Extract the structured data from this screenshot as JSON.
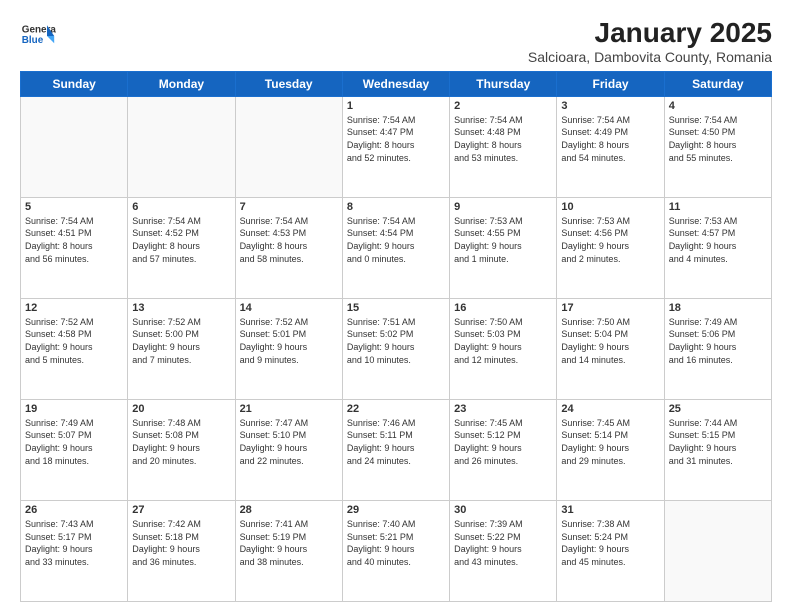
{
  "header": {
    "logo": {
      "general": "General",
      "blue": "Blue"
    },
    "title": "January 2025",
    "subtitle": "Salcioara, Dambovita County, Romania"
  },
  "days_of_week": [
    "Sunday",
    "Monday",
    "Tuesday",
    "Wednesday",
    "Thursday",
    "Friday",
    "Saturday"
  ],
  "weeks": [
    [
      {
        "day": "",
        "info": ""
      },
      {
        "day": "",
        "info": ""
      },
      {
        "day": "",
        "info": ""
      },
      {
        "day": "1",
        "info": "Sunrise: 7:54 AM\nSunset: 4:47 PM\nDaylight: 8 hours\nand 52 minutes."
      },
      {
        "day": "2",
        "info": "Sunrise: 7:54 AM\nSunset: 4:48 PM\nDaylight: 8 hours\nand 53 minutes."
      },
      {
        "day": "3",
        "info": "Sunrise: 7:54 AM\nSunset: 4:49 PM\nDaylight: 8 hours\nand 54 minutes."
      },
      {
        "day": "4",
        "info": "Sunrise: 7:54 AM\nSunset: 4:50 PM\nDaylight: 8 hours\nand 55 minutes."
      }
    ],
    [
      {
        "day": "5",
        "info": "Sunrise: 7:54 AM\nSunset: 4:51 PM\nDaylight: 8 hours\nand 56 minutes."
      },
      {
        "day": "6",
        "info": "Sunrise: 7:54 AM\nSunset: 4:52 PM\nDaylight: 8 hours\nand 57 minutes."
      },
      {
        "day": "7",
        "info": "Sunrise: 7:54 AM\nSunset: 4:53 PM\nDaylight: 8 hours\nand 58 minutes."
      },
      {
        "day": "8",
        "info": "Sunrise: 7:54 AM\nSunset: 4:54 PM\nDaylight: 9 hours\nand 0 minutes."
      },
      {
        "day": "9",
        "info": "Sunrise: 7:53 AM\nSunset: 4:55 PM\nDaylight: 9 hours\nand 1 minute."
      },
      {
        "day": "10",
        "info": "Sunrise: 7:53 AM\nSunset: 4:56 PM\nDaylight: 9 hours\nand 2 minutes."
      },
      {
        "day": "11",
        "info": "Sunrise: 7:53 AM\nSunset: 4:57 PM\nDaylight: 9 hours\nand 4 minutes."
      }
    ],
    [
      {
        "day": "12",
        "info": "Sunrise: 7:52 AM\nSunset: 4:58 PM\nDaylight: 9 hours\nand 5 minutes."
      },
      {
        "day": "13",
        "info": "Sunrise: 7:52 AM\nSunset: 5:00 PM\nDaylight: 9 hours\nand 7 minutes."
      },
      {
        "day": "14",
        "info": "Sunrise: 7:52 AM\nSunset: 5:01 PM\nDaylight: 9 hours\nand 9 minutes."
      },
      {
        "day": "15",
        "info": "Sunrise: 7:51 AM\nSunset: 5:02 PM\nDaylight: 9 hours\nand 10 minutes."
      },
      {
        "day": "16",
        "info": "Sunrise: 7:50 AM\nSunset: 5:03 PM\nDaylight: 9 hours\nand 12 minutes."
      },
      {
        "day": "17",
        "info": "Sunrise: 7:50 AM\nSunset: 5:04 PM\nDaylight: 9 hours\nand 14 minutes."
      },
      {
        "day": "18",
        "info": "Sunrise: 7:49 AM\nSunset: 5:06 PM\nDaylight: 9 hours\nand 16 minutes."
      }
    ],
    [
      {
        "day": "19",
        "info": "Sunrise: 7:49 AM\nSunset: 5:07 PM\nDaylight: 9 hours\nand 18 minutes."
      },
      {
        "day": "20",
        "info": "Sunrise: 7:48 AM\nSunset: 5:08 PM\nDaylight: 9 hours\nand 20 minutes."
      },
      {
        "day": "21",
        "info": "Sunrise: 7:47 AM\nSunset: 5:10 PM\nDaylight: 9 hours\nand 22 minutes."
      },
      {
        "day": "22",
        "info": "Sunrise: 7:46 AM\nSunset: 5:11 PM\nDaylight: 9 hours\nand 24 minutes."
      },
      {
        "day": "23",
        "info": "Sunrise: 7:45 AM\nSunset: 5:12 PM\nDaylight: 9 hours\nand 26 minutes."
      },
      {
        "day": "24",
        "info": "Sunrise: 7:45 AM\nSunset: 5:14 PM\nDaylight: 9 hours\nand 29 minutes."
      },
      {
        "day": "25",
        "info": "Sunrise: 7:44 AM\nSunset: 5:15 PM\nDaylight: 9 hours\nand 31 minutes."
      }
    ],
    [
      {
        "day": "26",
        "info": "Sunrise: 7:43 AM\nSunset: 5:17 PM\nDaylight: 9 hours\nand 33 minutes."
      },
      {
        "day": "27",
        "info": "Sunrise: 7:42 AM\nSunset: 5:18 PM\nDaylight: 9 hours\nand 36 minutes."
      },
      {
        "day": "28",
        "info": "Sunrise: 7:41 AM\nSunset: 5:19 PM\nDaylight: 9 hours\nand 38 minutes."
      },
      {
        "day": "29",
        "info": "Sunrise: 7:40 AM\nSunset: 5:21 PM\nDaylight: 9 hours\nand 40 minutes."
      },
      {
        "day": "30",
        "info": "Sunrise: 7:39 AM\nSunset: 5:22 PM\nDaylight: 9 hours\nand 43 minutes."
      },
      {
        "day": "31",
        "info": "Sunrise: 7:38 AM\nSunset: 5:24 PM\nDaylight: 9 hours\nand 45 minutes."
      },
      {
        "day": "",
        "info": ""
      }
    ]
  ]
}
